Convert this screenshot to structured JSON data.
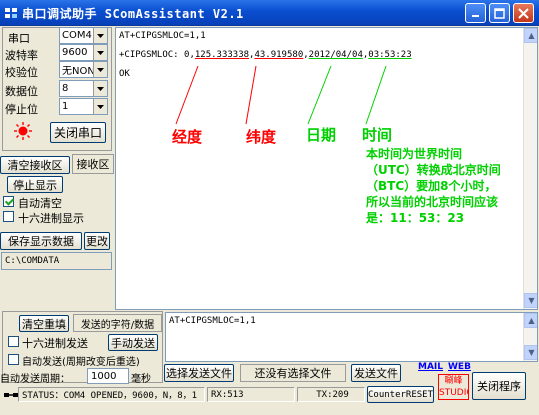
{
  "window": {
    "title": "串口调试助手 SComAssistant V2.1"
  },
  "settings": {
    "port_label": "串口",
    "port_value": "COM4",
    "baud_label": "波特率",
    "baud_value": "9600",
    "parity_label": "校验位",
    "parity_value": "无NONE",
    "databits_label": "数据位",
    "databits_value": "8",
    "stopbits_label": "停止位",
    "stopbits_value": "1",
    "close_port_button": "关闭串口"
  },
  "receive_controls": {
    "clear_button": "清空接收区",
    "receive_area_label": "接收区",
    "stop_display_button": "停止显示",
    "auto_clear_label": "自动清空",
    "hex_display_label": "十六进制显示",
    "save_data_button": "保存显示数据",
    "change_button": "更改",
    "save_path": "C:\\COMDATA"
  },
  "receive_text": {
    "line1": "AT+CIPGSMLOC=1,1",
    "line2_prefix": "+CIPGSMLOC: 0,",
    "longitude": "125.333338",
    "comma1": ",",
    "latitude": "43.919580",
    "comma2": ",",
    "date": "2012/04/04",
    "comma3": ",",
    "time": "03:53:23",
    "line3": "OK"
  },
  "annotations": {
    "longitude": "经度",
    "latitude": "纬度",
    "date": "日期",
    "time": "时间",
    "note": "本时间为世界时间（UTC）转换成北京时间（BTC）要加8个小时，所以当前的北京时间应该是：11：53：23"
  },
  "send_controls": {
    "clear_resend_button": "清空重填",
    "send_data_label": "发送的字符/数据",
    "hex_send_label": "十六进制发送",
    "manual_send_button": "手动发送",
    "auto_send_label": "自动发送(周期改变后重选)",
    "auto_period_label": "自动发送周期：",
    "period_value": "1000",
    "ms_label": "毫秒",
    "select_file_button": "选择发送文件",
    "no_file_label": "还没有选择文件",
    "send_file_button": "发送文件",
    "mail_link": "MAIL",
    "web_link": "WEB",
    "logo_text": "唰峰 STUDIO",
    "exit_button": "关闭程序"
  },
  "send_text": "AT+CIPGSMLOC=1,1",
  "status_bar": {
    "status": "STATUS：COM4 OPENED，9600，N，8，1",
    "rx": "RX:513",
    "tx": "TX:209",
    "counter_reset": "CounterRESET"
  },
  "colors": {
    "title_bar": "#0a4ed0",
    "annotation_red": "#ff0000",
    "annotation_green": "#00d000",
    "port_indicator": "#ff0000",
    "link": "#0000ff"
  }
}
